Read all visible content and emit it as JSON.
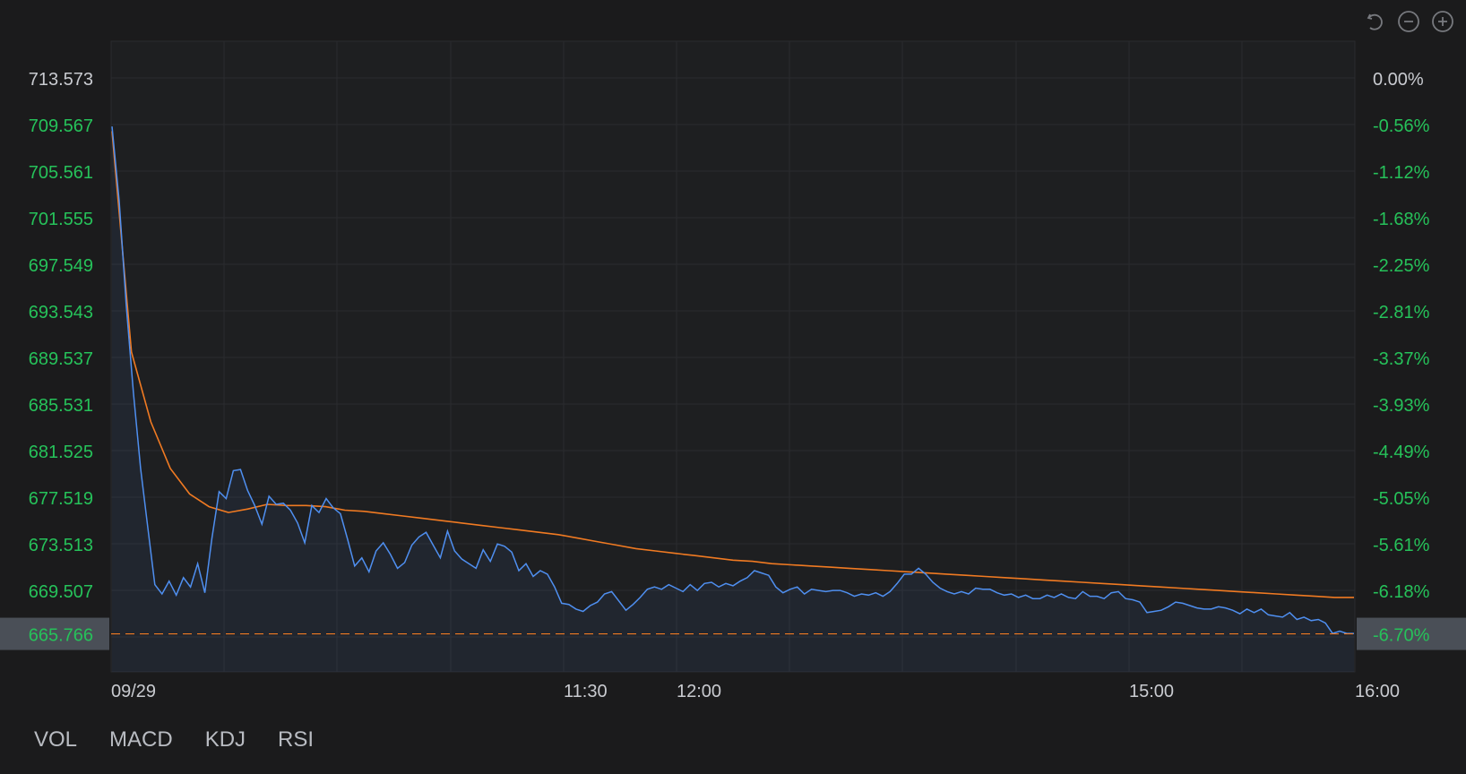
{
  "toolbar": {
    "icons": [
      "undo-icon",
      "zoom-out-icon",
      "zoom-in-icon"
    ]
  },
  "indicators": {
    "tabs": [
      "VOL",
      "MACD",
      "KDJ",
      "RSI"
    ]
  },
  "colors": {
    "background": "#1b1b1c",
    "grid": "#2a2b2e",
    "price_line": "#4f8ff0",
    "avg_line": "#f07a22",
    "axis_up_text": "#26c25a",
    "axis_neutral_text": "#c9cbd0",
    "time_text": "#c9cbd0",
    "current_label_bg": "#4a4f57"
  },
  "chart_data": {
    "type": "line",
    "left_axis_ticks": [
      "713.573",
      "709.567",
      "705.561",
      "701.555",
      "697.549",
      "693.543",
      "689.537",
      "685.531",
      "681.525",
      "677.519",
      "673.513",
      "669.507"
    ],
    "right_axis_ticks": [
      "0.00%",
      "-0.56%",
      "-1.12%",
      "-1.68%",
      "-2.25%",
      "-2.81%",
      "-3.37%",
      "-3.93%",
      "-4.49%",
      "-5.05%",
      "-5.61%",
      "-6.18%"
    ],
    "current_price_label": "665.766",
    "current_percent_label": "-6.70%",
    "x_tick_labels": [
      "09/29",
      "11:30",
      "12:00",
      "15:00",
      "16:00"
    ],
    "ylim": [
      665.5,
      713.573
    ],
    "series": [
      {
        "name": "price",
        "points": [
          [
            0,
            709.4
          ],
          [
            1,
            703.0
          ],
          [
            2,
            694.0
          ],
          [
            3,
            686.5
          ],
          [
            4,
            680.0
          ],
          [
            5,
            675.0
          ],
          [
            6,
            670.0
          ],
          [
            7,
            669.2
          ],
          [
            8,
            670.3
          ],
          [
            9,
            669.1
          ],
          [
            10,
            670.6
          ],
          [
            11,
            669.8
          ],
          [
            12,
            671.8
          ],
          [
            13,
            669.3
          ],
          [
            14,
            674.0
          ],
          [
            15,
            678.0
          ],
          [
            16,
            677.4
          ],
          [
            17,
            679.8
          ],
          [
            18,
            679.9
          ],
          [
            19,
            678.1
          ],
          [
            20,
            676.8
          ],
          [
            21,
            675.2
          ],
          [
            22,
            677.6
          ],
          [
            23,
            676.9
          ],
          [
            24,
            677.0
          ],
          [
            25,
            676.4
          ],
          [
            26,
            675.3
          ],
          [
            27,
            673.6
          ],
          [
            28,
            676.8
          ],
          [
            29,
            676.2
          ],
          [
            30,
            677.4
          ],
          [
            31,
            676.6
          ],
          [
            32,
            676.1
          ],
          [
            33,
            673.9
          ],
          [
            34,
            671.6
          ],
          [
            35,
            672.3
          ],
          [
            36,
            671.1
          ],
          [
            37,
            672.9
          ],
          [
            38,
            673.6
          ],
          [
            39,
            672.6
          ],
          [
            40,
            671.4
          ],
          [
            41,
            671.9
          ],
          [
            42,
            673.4
          ],
          [
            43,
            674.1
          ],
          [
            44,
            674.5
          ],
          [
            45,
            673.4
          ],
          [
            46,
            672.3
          ],
          [
            47,
            674.6
          ],
          [
            48,
            672.9
          ],
          [
            49,
            672.2
          ],
          [
            50,
            671.8
          ],
          [
            51,
            671.4
          ],
          [
            52,
            673.0
          ],
          [
            53,
            672.0
          ],
          [
            54,
            673.5
          ],
          [
            55,
            673.3
          ],
          [
            56,
            672.8
          ],
          [
            57,
            671.2
          ],
          [
            58,
            671.8
          ],
          [
            59,
            670.7
          ],
          [
            60,
            671.2
          ],
          [
            61,
            670.9
          ],
          [
            62,
            669.8
          ],
          [
            63,
            668.4
          ],
          [
            64,
            668.3
          ],
          [
            65,
            667.9
          ],
          [
            66,
            667.7
          ],
          [
            67,
            668.2
          ],
          [
            68,
            668.5
          ],
          [
            69,
            669.2
          ],
          [
            70,
            669.4
          ],
          [
            71,
            668.6
          ],
          [
            72,
            667.8
          ],
          [
            73,
            668.3
          ],
          [
            74,
            668.9
          ],
          [
            75,
            669.6
          ],
          [
            76,
            669.8
          ],
          [
            77,
            669.6
          ],
          [
            78,
            670.0
          ],
          [
            79,
            669.7
          ],
          [
            80,
            669.4
          ],
          [
            81,
            670.0
          ],
          [
            82,
            669.5
          ],
          [
            83,
            670.1
          ],
          [
            84,
            670.2
          ],
          [
            85,
            669.8
          ],
          [
            86,
            670.1
          ],
          [
            87,
            669.9
          ],
          [
            88,
            670.3
          ],
          [
            89,
            670.6
          ],
          [
            90,
            671.2
          ],
          [
            91,
            671.0
          ],
          [
            92,
            670.8
          ],
          [
            93,
            669.8
          ],
          [
            94,
            669.3
          ],
          [
            95,
            669.6
          ],
          [
            96,
            669.8
          ],
          [
            97,
            669.2
          ],
          [
            98,
            669.6
          ],
          [
            99,
            669.5
          ],
          [
            100,
            669.4
          ],
          [
            101,
            669.5
          ],
          [
            102,
            669.5
          ],
          [
            103,
            669.3
          ],
          [
            104,
            669.0
          ],
          [
            105,
            669.2
          ],
          [
            106,
            669.1
          ],
          [
            107,
            669.3
          ],
          [
            108,
            669.0
          ],
          [
            109,
            669.4
          ],
          [
            110,
            670.1
          ],
          [
            111,
            670.9
          ],
          [
            112,
            670.9
          ],
          [
            113,
            671.4
          ],
          [
            114,
            670.9
          ],
          [
            115,
            670.2
          ],
          [
            116,
            669.7
          ],
          [
            117,
            669.4
          ],
          [
            118,
            669.2
          ],
          [
            119,
            669.4
          ],
          [
            120,
            669.2
          ],
          [
            121,
            669.7
          ],
          [
            122,
            669.6
          ],
          [
            123,
            669.6
          ],
          [
            124,
            669.3
          ],
          [
            125,
            669.1
          ],
          [
            126,
            669.2
          ],
          [
            127,
            668.9
          ],
          [
            128,
            669.1
          ],
          [
            129,
            668.8
          ],
          [
            130,
            668.8
          ],
          [
            131,
            669.1
          ],
          [
            132,
            668.9
          ],
          [
            133,
            669.2
          ],
          [
            134,
            668.9
          ],
          [
            135,
            668.8
          ],
          [
            136,
            669.4
          ],
          [
            137,
            669.0
          ],
          [
            138,
            669.0
          ],
          [
            139,
            668.8
          ],
          [
            140,
            669.3
          ],
          [
            141,
            669.4
          ],
          [
            142,
            668.8
          ],
          [
            143,
            668.7
          ],
          [
            144,
            668.5
          ],
          [
            145,
            667.6
          ],
          [
            146,
            667.7
          ],
          [
            147,
            667.8
          ],
          [
            148,
            668.1
          ],
          [
            149,
            668.5
          ],
          [
            150,
            668.4
          ],
          [
            151,
            668.2
          ],
          [
            152,
            668.0
          ],
          [
            153,
            667.9
          ],
          [
            154,
            667.9
          ],
          [
            155,
            668.1
          ],
          [
            156,
            668.0
          ],
          [
            157,
            667.8
          ],
          [
            158,
            667.5
          ],
          [
            159,
            667.9
          ],
          [
            160,
            667.6
          ],
          [
            161,
            667.9
          ],
          [
            162,
            667.4
          ],
          [
            163,
            667.3
          ],
          [
            164,
            667.2
          ],
          [
            165,
            667.6
          ],
          [
            166,
            667.0
          ],
          [
            167,
            667.2
          ],
          [
            168,
            666.9
          ],
          [
            169,
            667.0
          ],
          [
            170,
            666.7
          ],
          [
            171,
            665.8
          ],
          [
            172,
            666.0
          ],
          [
            173,
            665.8
          ],
          [
            174,
            665.8
          ]
        ]
      },
      {
        "name": "average",
        "points": [
          [
            0,
            709.0
          ],
          [
            1,
            690.0
          ],
          [
            2,
            684.0
          ],
          [
            3,
            680.0
          ],
          [
            4,
            677.8
          ],
          [
            5,
            676.7
          ],
          [
            6,
            676.2
          ],
          [
            7,
            676.5
          ],
          [
            8,
            676.9
          ],
          [
            9,
            676.8
          ],
          [
            10,
            676.8
          ],
          [
            11,
            676.7
          ],
          [
            12,
            676.4
          ],
          [
            13,
            676.3
          ],
          [
            14,
            676.1
          ],
          [
            15,
            675.9
          ],
          [
            16,
            675.7
          ],
          [
            17,
            675.5
          ],
          [
            18,
            675.3
          ],
          [
            19,
            675.1
          ],
          [
            20,
            674.9
          ],
          [
            21,
            674.7
          ],
          [
            22,
            674.5
          ],
          [
            23,
            674.3
          ],
          [
            24,
            674.0
          ],
          [
            25,
            673.7
          ],
          [
            26,
            673.4
          ],
          [
            27,
            673.1
          ],
          [
            28,
            672.9
          ],
          [
            29,
            672.7
          ],
          [
            30,
            672.5
          ],
          [
            31,
            672.3
          ],
          [
            32,
            672.1
          ],
          [
            33,
            672.0
          ],
          [
            34,
            671.8
          ],
          [
            35,
            671.7
          ],
          [
            36,
            671.6
          ],
          [
            37,
            671.5
          ],
          [
            38,
            671.4
          ],
          [
            39,
            671.3
          ],
          [
            40,
            671.2
          ],
          [
            41,
            671.1
          ],
          [
            42,
            671.0
          ],
          [
            43,
            670.9
          ],
          [
            44,
            670.8
          ],
          [
            45,
            670.7
          ],
          [
            46,
            670.6
          ],
          [
            47,
            670.5
          ],
          [
            48,
            670.4
          ],
          [
            49,
            670.3
          ],
          [
            50,
            670.2
          ],
          [
            51,
            670.1
          ],
          [
            52,
            670.0
          ],
          [
            53,
            669.9
          ],
          [
            54,
            669.8
          ],
          [
            55,
            669.7
          ],
          [
            56,
            669.6
          ],
          [
            57,
            669.5
          ],
          [
            58,
            669.4
          ],
          [
            59,
            669.3
          ],
          [
            60,
            669.2
          ],
          [
            61,
            669.1
          ],
          [
            62,
            669.0
          ],
          [
            63,
            668.9
          ],
          [
            64,
            668.9
          ]
        ]
      }
    ]
  }
}
